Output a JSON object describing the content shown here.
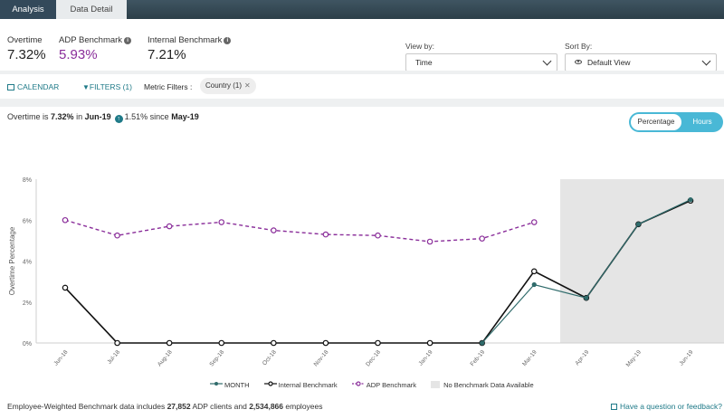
{
  "tabs": [
    {
      "label": "Analysis",
      "active": true
    },
    {
      "label": "Data Detail",
      "active": false
    }
  ],
  "metrics": {
    "overtime": {
      "label": "Overtime",
      "value": "7.32%"
    },
    "adp": {
      "label": "ADP Benchmark",
      "value": "5.93%"
    },
    "internal": {
      "label": "Internal Benchmark",
      "value": "7.21%"
    }
  },
  "view_by": {
    "label": "View by:",
    "value": "Time"
  },
  "sort_by": {
    "label": "Sort By:",
    "value": "Default View"
  },
  "filterbar": {
    "calendar": "CALENDAR",
    "filters": "FILTERS (1)",
    "metric_filters": "Metric Filters :",
    "chip": "Country (1)"
  },
  "summary": {
    "prefix": "Overtime is",
    "value": "7.32%",
    "in": "in",
    "month": "Jun-19",
    "change": "1.51%",
    "since": "since",
    "since_month": "May-19"
  },
  "toggle": {
    "percentage": "Percentage",
    "hours": "Hours",
    "selected": "Percentage"
  },
  "colors": {
    "month": "#2f6b6b",
    "internal": "#111111",
    "adp": "#8a2e9a",
    "no_data": "#e5e5e5",
    "accent": "#49b8d6"
  },
  "chart_data": {
    "type": "line",
    "ylabel": "Overtime Percentage",
    "ylim": [
      0,
      8
    ],
    "yticks": [
      "0%",
      "2%",
      "4%",
      "6%",
      "8%"
    ],
    "categories": [
      "Jun-18",
      "Jul-18",
      "Aug-18",
      "Sep-18",
      "Oct-18",
      "Nov-18",
      "Dec-18",
      "Jan-19",
      "Feb-19",
      "Mar-19",
      "Apr-19",
      "May-19",
      "Jun-19"
    ],
    "no_benchmark_from_index": 10,
    "series": [
      {
        "name": "MONTH",
        "values": [
          null,
          null,
          null,
          null,
          null,
          null,
          null,
          null,
          0,
          2.85,
          2.2,
          5.8,
          7.0
        ]
      },
      {
        "name": "Internal Benchmark",
        "values": [
          2.7,
          0,
          0,
          0,
          0,
          0,
          0,
          0,
          0,
          3.5,
          2.2,
          5.8,
          6.95
        ]
      },
      {
        "name": "ADP Benchmark",
        "values": [
          6.0,
          5.25,
          5.7,
          5.9,
          5.5,
          5.3,
          5.25,
          4.95,
          5.1,
          5.9,
          null,
          null,
          null
        ]
      }
    ],
    "legend": [
      "MONTH",
      "Internal Benchmark",
      "ADP Benchmark",
      "No Benchmark Data Available"
    ]
  },
  "footer": {
    "prefix": "Employee-Weighted Benchmark data includes",
    "clients": "27,852",
    "mid": "ADP clients and",
    "employees": "2,534,866",
    "suffix": "employees",
    "feedback": "Have a question or feedback?"
  }
}
